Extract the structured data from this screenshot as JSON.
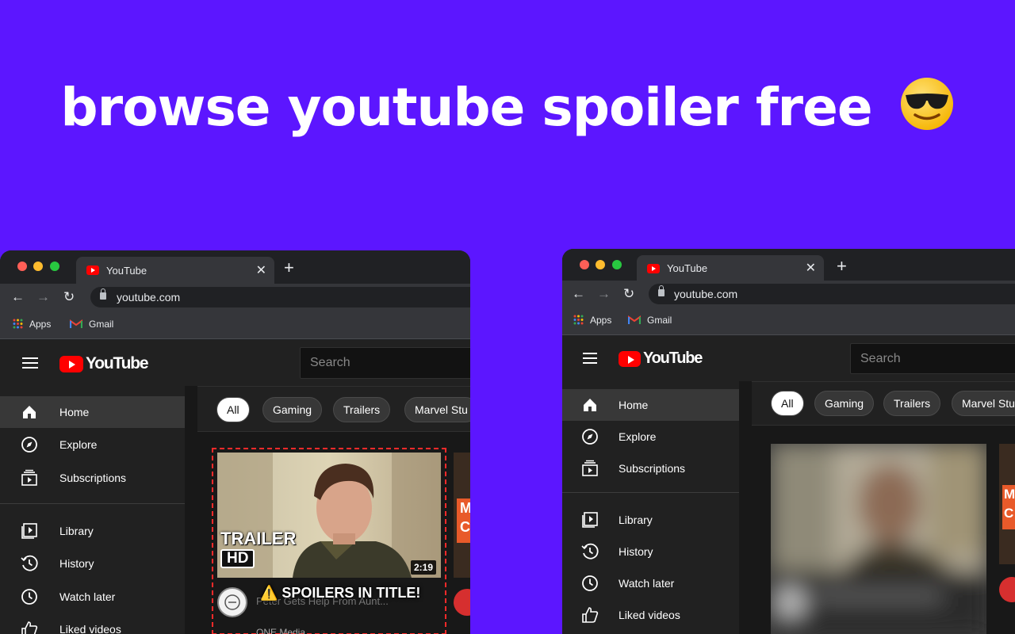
{
  "headline": {
    "text": "browse youtube spoiler free",
    "emoji": "sunglasses-emoji"
  },
  "browser": {
    "tab_title": "YouTube",
    "tab_close": "✕",
    "new_tab": "+",
    "url": "youtube.com",
    "bookmarks": [
      "Apps",
      "Gmail"
    ]
  },
  "youtube": {
    "logo_text": "YouTube",
    "search_placeholder": "Search",
    "sidebar_main": [
      "Home",
      "Explore",
      "Subscriptions"
    ],
    "sidebar_library": [
      "Library",
      "History",
      "Watch later",
      "Liked videos"
    ],
    "chips": [
      "All",
      "Gaming",
      "Trailers",
      "Marvel Stu"
    ]
  },
  "left_video": {
    "thumb_text_1": "TRAILER",
    "thumb_text_2": "HD",
    "duration": "2:19",
    "warning": "⚠️ SPOILERS IN TITLE!",
    "hidden_title": "Peter Gets Help From Aunt...",
    "channel": "ONE Media"
  },
  "side_peek": {
    "text_top": "M",
    "text_bottom": "C"
  },
  "colors": {
    "background": "#5c16ff",
    "warning_border": "#ff2a2a",
    "yt_red": "#ff0000"
  }
}
